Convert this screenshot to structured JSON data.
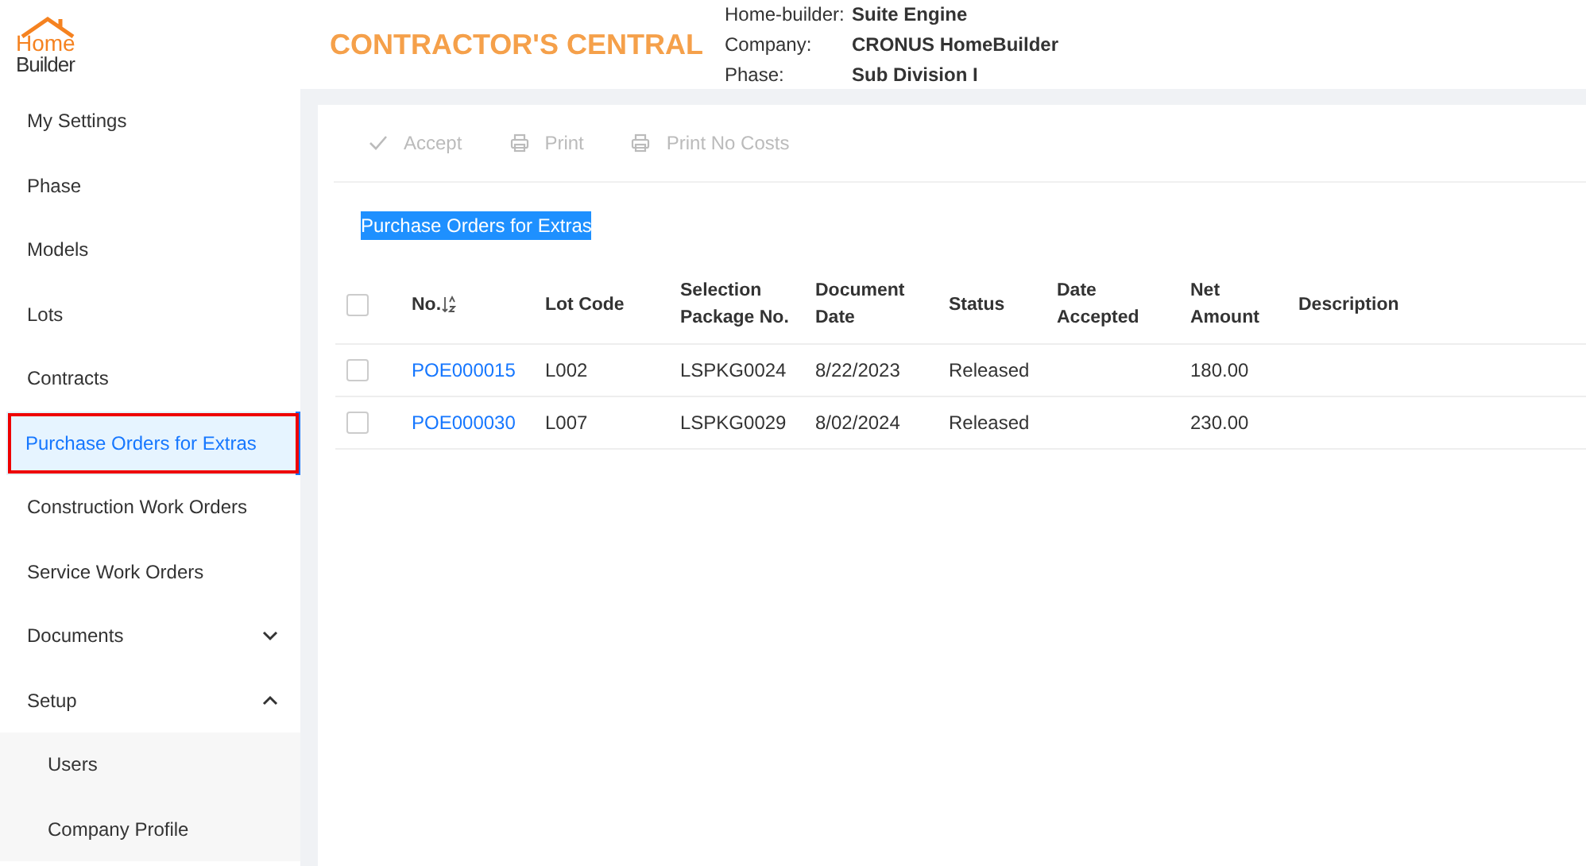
{
  "header": {
    "logo": {
      "line_1": "Home",
      "line_2": "Builder"
    },
    "title": "CONTRACTOR'S CENTRAL",
    "info": [
      {
        "label": "Home-builder:",
        "value": "Suite Engine"
      },
      {
        "label": "Company:",
        "value": "CRONUS HomeBuilder"
      },
      {
        "label": "Phase:",
        "value": "Sub Division I"
      }
    ]
  },
  "sidebar": {
    "items": [
      {
        "label": "My Settings",
        "selected": false
      },
      {
        "label": "Phase",
        "selected": false
      },
      {
        "label": "Models",
        "selected": false
      },
      {
        "label": "Lots",
        "selected": false
      },
      {
        "label": "Contracts",
        "selected": false
      },
      {
        "label": "Purchase Orders for Extras",
        "selected": true
      },
      {
        "label": "Construction Work Orders",
        "selected": false
      },
      {
        "label": "Service Work Orders",
        "selected": false
      },
      {
        "label": "Documents",
        "selected": false,
        "expanded": false
      },
      {
        "label": "Setup",
        "selected": false,
        "expanded": true,
        "children": [
          {
            "label": "Users",
            "selected": false
          },
          {
            "label": "Company Profile",
            "selected": false
          }
        ]
      }
    ]
  },
  "toolbar": [
    {
      "label": "Accept",
      "kind": "check",
      "disabled": true
    },
    {
      "label": "Print",
      "kind": "printer",
      "disabled": true
    },
    {
      "label": "Print No Costs",
      "kind": "printer",
      "disabled": true
    }
  ],
  "page_title": {
    "text": "Purchase Orders for Extras",
    "highlighted": true
  },
  "table": {
    "columns": [
      {
        "label": "No.",
        "sortable": true
      },
      {
        "label": "Lot Code"
      },
      {
        "label": "Selection Package No."
      },
      {
        "label": "Document Date"
      },
      {
        "label": "Status"
      },
      {
        "label": "Date Accepted"
      },
      {
        "label": "Net Amount"
      },
      {
        "label": "Description"
      }
    ],
    "all_checked": false,
    "rows": [
      {
        "checked": false,
        "cells": [
          "POE000015",
          "L002",
          "LSPKG0024",
          "8/22/2023",
          "Released",
          "",
          "180.00",
          ""
        ]
      },
      {
        "checked": false,
        "cells": [
          "POE000030",
          "L007",
          "LSPKG0029",
          "8/02/2024",
          "Released",
          "",
          "230.00",
          ""
        ]
      }
    ]
  }
}
